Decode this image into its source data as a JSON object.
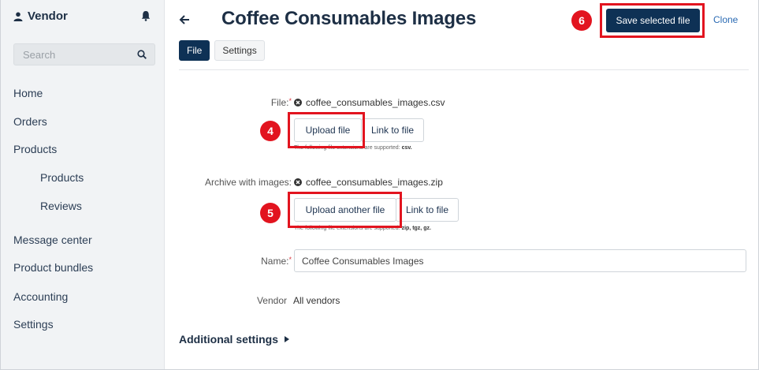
{
  "sidebar": {
    "brand": "Vendor",
    "search_placeholder": "Search",
    "items": [
      {
        "label": "Home"
      },
      {
        "label": "Orders"
      },
      {
        "label": "Products"
      },
      {
        "label": "Products"
      },
      {
        "label": "Reviews"
      },
      {
        "label": "Message center"
      },
      {
        "label": "Product bundles"
      },
      {
        "label": "Accounting"
      },
      {
        "label": "Settings"
      }
    ]
  },
  "header": {
    "title": "Coffee Consumables Images",
    "save_label": "Save selected file",
    "clone_label": "Clone"
  },
  "tabs": [
    {
      "label": "File"
    },
    {
      "label": "Settings"
    }
  ],
  "form": {
    "file": {
      "label": "File:",
      "required_mark": "*",
      "value": "coffee_consumables_images.csv",
      "upload_label": "Upload file",
      "link_label": "Link to file",
      "hint_prefix": "The following file extensions are supported:",
      "hint_ext": "csv."
    },
    "archive": {
      "label": "Archive with images:",
      "value": "coffee_consumables_images.zip",
      "upload_label": "Upload another file",
      "link_label": "Link to file",
      "hint_prefix": "The following file extensions are supported:",
      "hint_ext": "zip, tgz, gz."
    },
    "name": {
      "label": "Name:",
      "required_mark": "*",
      "value": "Coffee Consumables Images"
    },
    "vendor": {
      "label": "Vendor",
      "value": "All vendors"
    },
    "additional_label": "Additional settings"
  },
  "annotations": {
    "step_upload_file": "4",
    "step_upload_another": "5",
    "step_save": "6",
    "highlight_color": "#e2141f"
  },
  "colors": {
    "primary": "#0e3155",
    "link": "#2a6ab3",
    "required": "#d9363e"
  }
}
